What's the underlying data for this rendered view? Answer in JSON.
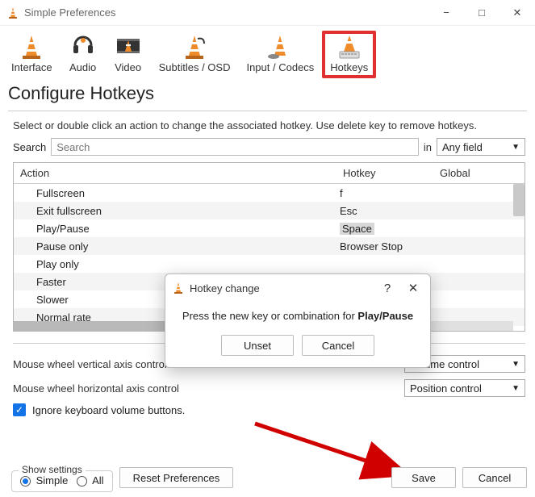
{
  "window": {
    "title": "Simple Preferences"
  },
  "tabs": {
    "interface": "Interface",
    "audio": "Audio",
    "video": "Video",
    "subtitles": "Subtitles / OSD",
    "input_codecs": "Input / Codecs",
    "hotkeys": "Hotkeys"
  },
  "heading": "Configure Hotkeys",
  "instr": "Select or double click an action to change the associated hotkey. Use delete key to remove hotkeys.",
  "search": {
    "label": "Search",
    "placeholder": "Search",
    "in_label": "in",
    "field": "Any field"
  },
  "columns": {
    "action": "Action",
    "hotkey": "Hotkey",
    "global": "Global"
  },
  "rows": [
    {
      "action": "Fullscreen",
      "hotkey": "f"
    },
    {
      "action": "Exit fullscreen",
      "hotkey": "Esc"
    },
    {
      "action": "Play/Pause",
      "hotkey": "Space",
      "hl": true
    },
    {
      "action": "Pause only",
      "hotkey": "Browser Stop"
    },
    {
      "action": "Play only",
      "hotkey": ""
    },
    {
      "action": "Faster",
      "hotkey": ""
    },
    {
      "action": "Slower",
      "hotkey": ""
    },
    {
      "action": "Normal rate",
      "hotkey": ""
    }
  ],
  "options": {
    "wheel_v_label": "Mouse wheel vertical axis control",
    "wheel_v_value": "Volume control",
    "wheel_h_label": "Mouse wheel horizontal axis control",
    "wheel_h_value": "Position control",
    "ignore_kb": "Ignore keyboard volume buttons."
  },
  "footer": {
    "show_settings": "Show settings",
    "simple": "Simple",
    "all": "All",
    "reset": "Reset Preferences",
    "save": "Save",
    "cancel": "Cancel"
  },
  "dialog": {
    "title": "Hotkey change",
    "msg_prefix": "Press the new key or combination for ",
    "msg_action": "Play/Pause",
    "unset": "Unset",
    "cancel": "Cancel"
  }
}
